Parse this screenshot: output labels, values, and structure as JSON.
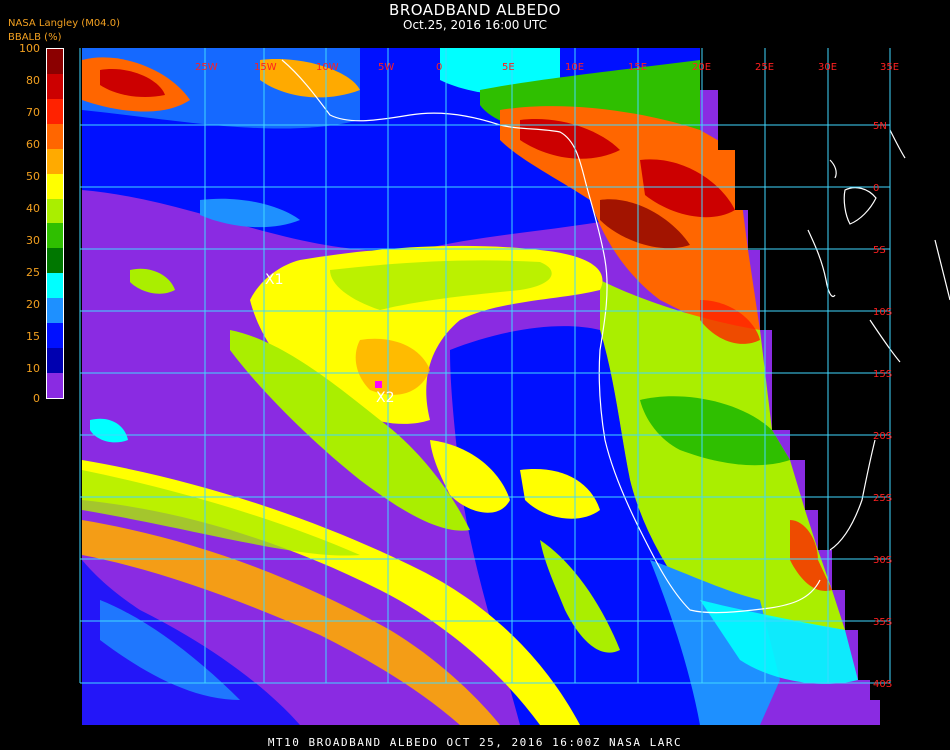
{
  "header": {
    "title": "BROADBAND ALBEDO",
    "subtitle": "Oct.25, 2016 16:00 UTC",
    "source": "NASA Langley (M04.0)"
  },
  "colorbar": {
    "label": "BBALB (%)",
    "ticks": [
      "100",
      "80",
      "70",
      "60",
      "50",
      "40",
      "30",
      "25",
      "20",
      "15",
      "10",
      "0"
    ],
    "colors": [
      "#8b0000",
      "#cc0000",
      "#ff2200",
      "#ff6600",
      "#ffaa00",
      "#ffff00",
      "#aaee00",
      "#2fbf00",
      "#007700",
      "#00ffff",
      "#1e90ff",
      "#0010ff",
      "#0000b0",
      "#8a2be2"
    ]
  },
  "grid": {
    "lon_labels": [
      "25W",
      "15W",
      "10W",
      "5W",
      "0",
      "5E",
      "10E",
      "15E",
      "20E",
      "25E",
      "30E",
      "35E"
    ],
    "lat_labels": [
      "5N",
      "0",
      "5S",
      "10S",
      "15S",
      "20S",
      "25S",
      "30S",
      "35S",
      "40S"
    ],
    "color": "#40d8ff",
    "label_color": "#ff2020"
  },
  "markers": [
    {
      "label": "X1",
      "color": "#ffffff"
    },
    {
      "label": "X2",
      "color": "#ffffff",
      "dot_color": "#ff00ff"
    }
  ],
  "footer": "MT10   BROADBAND ALBEDO   OCT 25, 2016 16:00Z   NASA LARC"
}
